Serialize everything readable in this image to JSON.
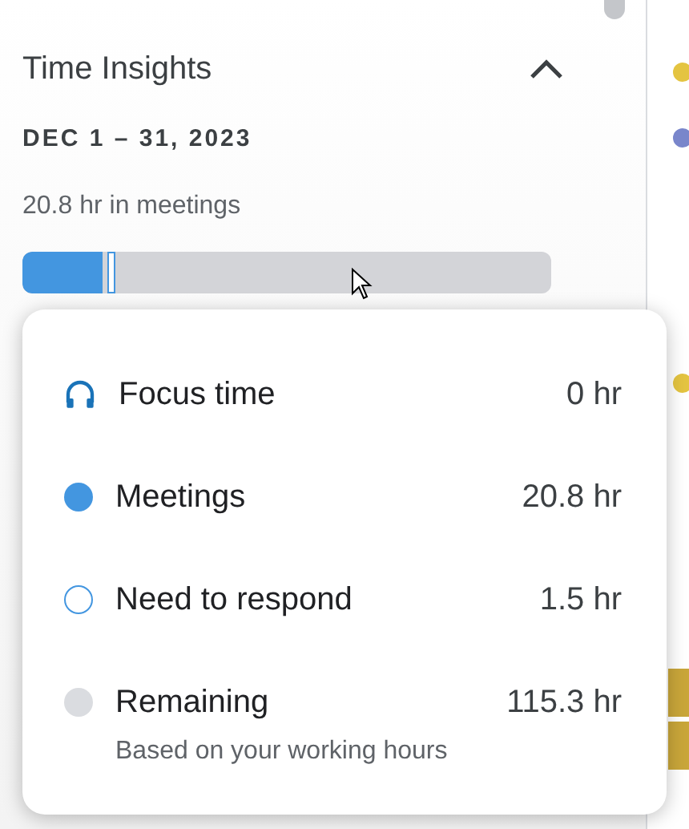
{
  "header": {
    "title": "Time Insights",
    "expanded": true
  },
  "date_range": "DEC 1 – 31, 2023",
  "summary": "20.8 hr in meetings",
  "bar": [
    {
      "kind": "meetings",
      "level": 0.15
    },
    {
      "kind": "respond"
    }
  ],
  "breakdown": [
    {
      "kind": "focus",
      "label": "Focus time",
      "value": "0 hr"
    },
    {
      "kind": "meetings",
      "label": "Meetings",
      "value": "20.8 hr"
    },
    {
      "kind": "respond",
      "label": "Need to respond",
      "value": "1.5 hr"
    },
    {
      "kind": "remaining",
      "label": "Remaining",
      "value": "115.3 hr",
      "note": "Based on your working hours"
    }
  ],
  "calendar_dots": [
    {
      "color": "#e4c441"
    },
    {
      "color": "#7986cb"
    },
    {
      "color": "#e4c441"
    }
  ]
}
